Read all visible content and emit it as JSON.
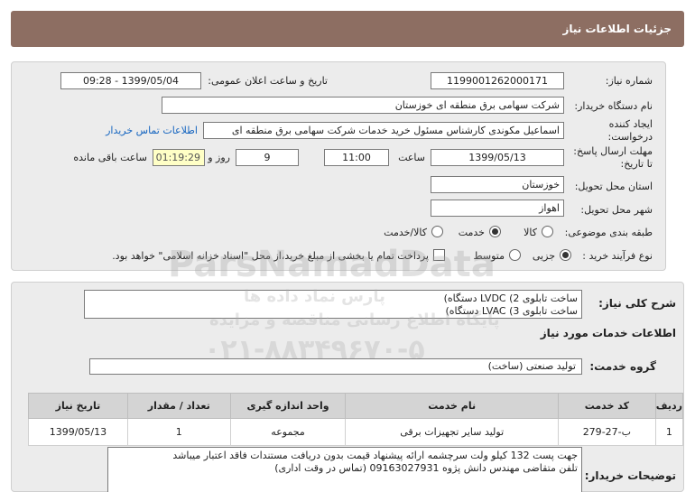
{
  "header": {
    "title": "جزئیات اطلاعات نیاز"
  },
  "need": {
    "number_label": "شماره نیاز:",
    "number_value": "1199001262000171",
    "announce_label": "تاریخ و ساعت اعلان عمومی:",
    "announce_value": "1399/05/04 - 09:28",
    "buyer_label": "نام دستگاه خریدار:",
    "buyer_value": "شرکت سهامی برق منطقه ای خوزستان",
    "creator_label_1": "ایجاد کننده",
    "creator_label_2": "درخواست:",
    "creator_value": "اسماعیل مکوندی کارشناس مسئول خرید خدمات شرکت سهامی برق منطقه ای",
    "contact_link": "اطلاعات تماس خریدار",
    "deadline_label_1": "مهلت ارسال پاسخ:",
    "deadline_label_2": "تا تاریخ:",
    "deadline_date": "1399/05/13",
    "time_label": "ساعت",
    "deadline_time": "11:00",
    "days_value": "9",
    "days_label": "روز و",
    "remaining_value": "01:19:29",
    "remaining_label": "ساعت باقی مانده",
    "province_label": "استان محل تحویل:",
    "province_value": "خوزستان",
    "city_label": "شهر محل تحویل:",
    "city_value": "اهواز",
    "category_label": "طبقه بندی موضوعی:",
    "category_options": [
      "کالا",
      "خدمت",
      "کالا/خدمت"
    ],
    "category_selected": "خدمت",
    "process_label": "نوع فرآیند خرید :",
    "process_options": [
      "جزیی",
      "متوسط"
    ],
    "process_selected": "جزیی",
    "payment_note": "پرداخت تمام یا بخشی از مبلغ خرید،از محل \"اسناد خزانه اسلامی\" خواهد بود."
  },
  "summary": {
    "label": "شرح کلی نیاز:",
    "line1": "ساخت تابلوی 2)   LVDC دستگاه)",
    "line2": "ساخت تابلوی  3)   LVAC دستگاه)"
  },
  "services": {
    "section_title": "اطلاعات خدمات مورد نیاز",
    "group_label": "گروه خدمت:",
    "group_value": "تولید صنعتی (ساخت)",
    "table": {
      "headers": [
        "ردیف",
        "کد خدمت",
        "نام خدمت",
        "واحد اندازه گیری",
        "تعداد / مقدار",
        "تاریخ نیاز"
      ],
      "rows": [
        [
          "1",
          "ب-27-279",
          "تولید سایر تجهیزات برقی",
          "مجموعه",
          "1",
          "1399/05/13"
        ]
      ]
    }
  },
  "buyer_notes": {
    "label": "توضیحات خریدار:",
    "line1": "جهت پست 132 کیلو ولت سرچشمه    ارائه پیشنهاد قیمت بدون دریافت مستندات فاقد اعتبار میباشد",
    "line2": "تلفن متقاضی مهندس دانش پژوه  09163027931  (تماس در وقت اداری)"
  },
  "watermark": {
    "brand": "ParsNamadData",
    "line_fa_1": "پایگاه اطلاع رسانی مناقصه و مزایده",
    "line_fa_2": "پارس نماد داده ها",
    "phone": "۰۲۱-۸۸۳۴۹۶۷۰-۵"
  }
}
